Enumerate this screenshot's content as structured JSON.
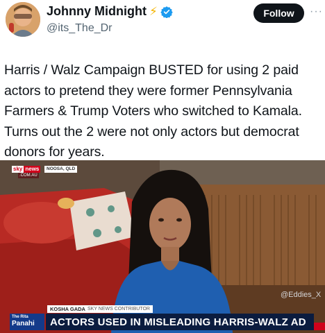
{
  "author": {
    "display_name": "Johnny Midnight",
    "handle": "@its_The_Dr",
    "verified": true
  },
  "follow_label": "Follow",
  "more_label": "···",
  "post_text": "Harris / Walz Campaign BUSTED for using 2 paid actors to pretend they were former Pennsylvania Farmers & Trump Voters who switched to Kamala. Turns out the 2 were not only actors but democrat donors for years.",
  "media": {
    "broadcaster_sky": "sky",
    "broadcaster_news": "news",
    "location": "NOOSA, QLD",
    "domain": ".COM.AU",
    "watermark": "@Eddies_X",
    "contributor_name": "KOSHA GADA",
    "contributor_role": "SKY NEWS CONTRIBUTOR",
    "show_logo_top": "The Rita",
    "show_logo_main": "Panahi",
    "headline": "ACTORS USED IN MISLEADING HARRIS-WALZ AD"
  },
  "colors": {
    "follow_bg": "#0f1419",
    "verified": "#1d9bf0",
    "bolt": "#f4b400",
    "headline_bg": "#0b1c3f",
    "sky_red": "#d0021b"
  }
}
